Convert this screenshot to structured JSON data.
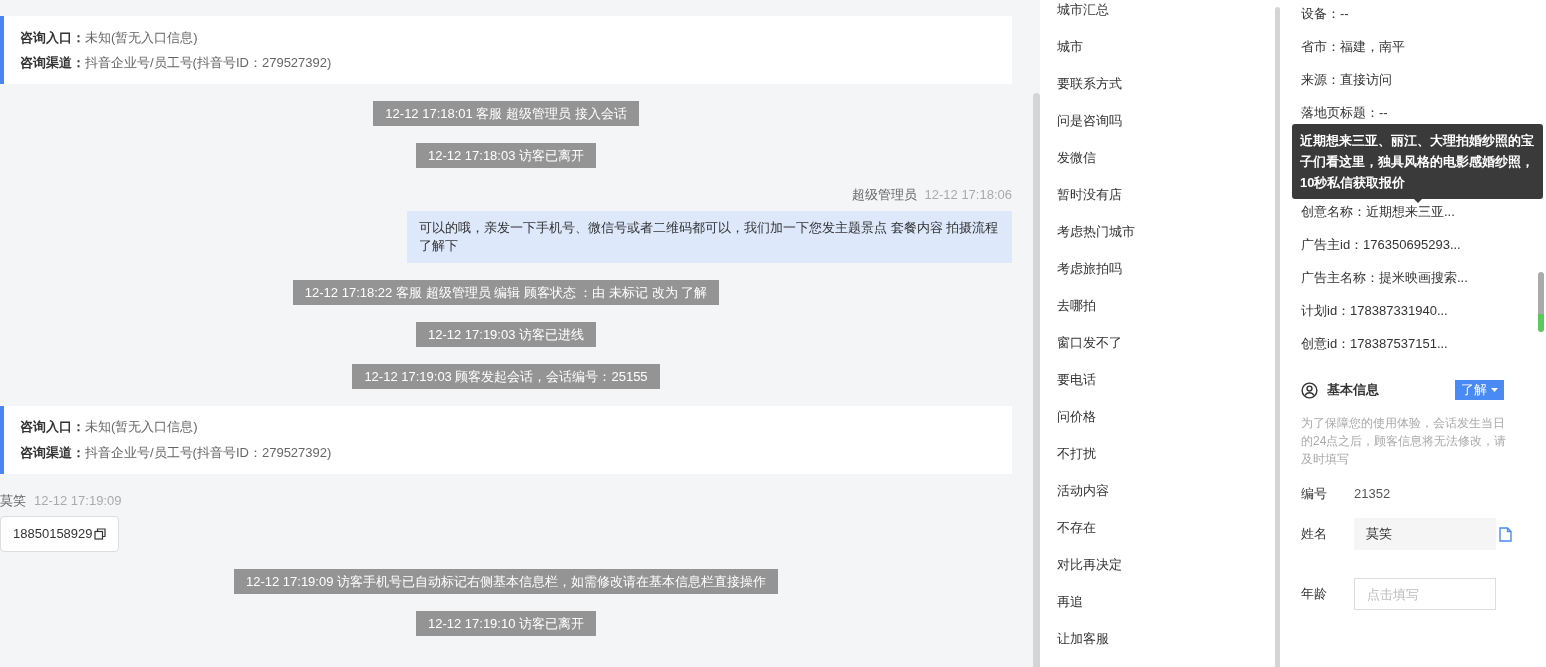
{
  "chat": {
    "messages": [
      {
        "kind": "entry_card",
        "entry_label": "咨询入口：",
        "entry_value": "未知(暂无入口信息)",
        "channel_label": "咨询渠道：",
        "channel_value": "抖音企业号/员工号(抖音号ID：279527392)"
      },
      {
        "kind": "system",
        "text": "12-12 17:18:01 客服 超级管理员 接入会话"
      },
      {
        "kind": "system",
        "text": "12-12 17:18:03 访客已离开"
      },
      {
        "kind": "agent_message",
        "sender": "超级管理员",
        "time": "12-12 17:18:06",
        "text": "可以的哦，亲发一下手机号、微信号或者二维码都可以，我们加一下您发主题景点 套餐内容 拍摄流程了解下"
      },
      {
        "kind": "system",
        "text": "12-12 17:18:22 客服 超级管理员 编辑 顾客状态 ：由 未标记 改为 了解"
      },
      {
        "kind": "system",
        "text": "12-12 17:19:03 访客已进线"
      },
      {
        "kind": "system",
        "text": "12-12 17:19:03 顾客发起会话，会话编号：25155"
      },
      {
        "kind": "entry_card",
        "entry_label": "咨询入口：",
        "entry_value": "未知(暂无入口信息)",
        "channel_label": "咨询渠道：",
        "channel_value": "抖音企业号/员工号(抖音号ID：279527392)"
      },
      {
        "kind": "visitor_phone",
        "sender": "莫笑",
        "time": "12-12 17:19:09",
        "text": "18850158929"
      },
      {
        "kind": "system",
        "text": "12-12 17:19:09 访客手机号已自动标记右侧基本信息栏，如需修改请在基本信息栏直接操作"
      },
      {
        "kind": "system",
        "text": "12-12 17:19:10 访客已离开"
      }
    ]
  },
  "tag_list": {
    "items": [
      "城市汇总",
      "城市",
      "要联系方式",
      "问是咨询吗",
      "发微信",
      "暂时没有店",
      "考虑热门城市",
      "考虑旅拍吗",
      "去哪拍",
      "窗口发不了",
      "要电话",
      "问价格",
      "不打扰",
      "活动内容",
      "不存在",
      "对比再决定",
      "再追",
      "让加客服"
    ]
  },
  "visitor_info": {
    "rows_top": [
      "设备：--",
      "省市：福建，南平",
      "来源：直接访问",
      "落地页标题：--"
    ],
    "rows_bottom": [
      "创意名称：近期想来三亚...",
      "广告主id：176350695293...",
      "广告主名称：提米映画搜索...",
      "计划id：178387331940...",
      "创意id：178387537151..."
    ],
    "tooltip": "近期想来三亚、丽江、大理拍婚纱照的宝子们看这里，独具风格的电影感婚纱照，10秒私信获取报价"
  },
  "basic_info": {
    "title": "基本信息",
    "status": "了解",
    "note": "为了保障您的使用体验，会话发生当日的24点之后，顾客信息将无法修改，请及时填写",
    "fields": [
      {
        "kind": "text",
        "label": "编号",
        "value": "21352"
      },
      {
        "kind": "filled",
        "label": "姓名",
        "value": "莫笑"
      },
      {
        "kind": "input",
        "label": "年龄",
        "placeholder": "点击填写"
      }
    ]
  }
}
